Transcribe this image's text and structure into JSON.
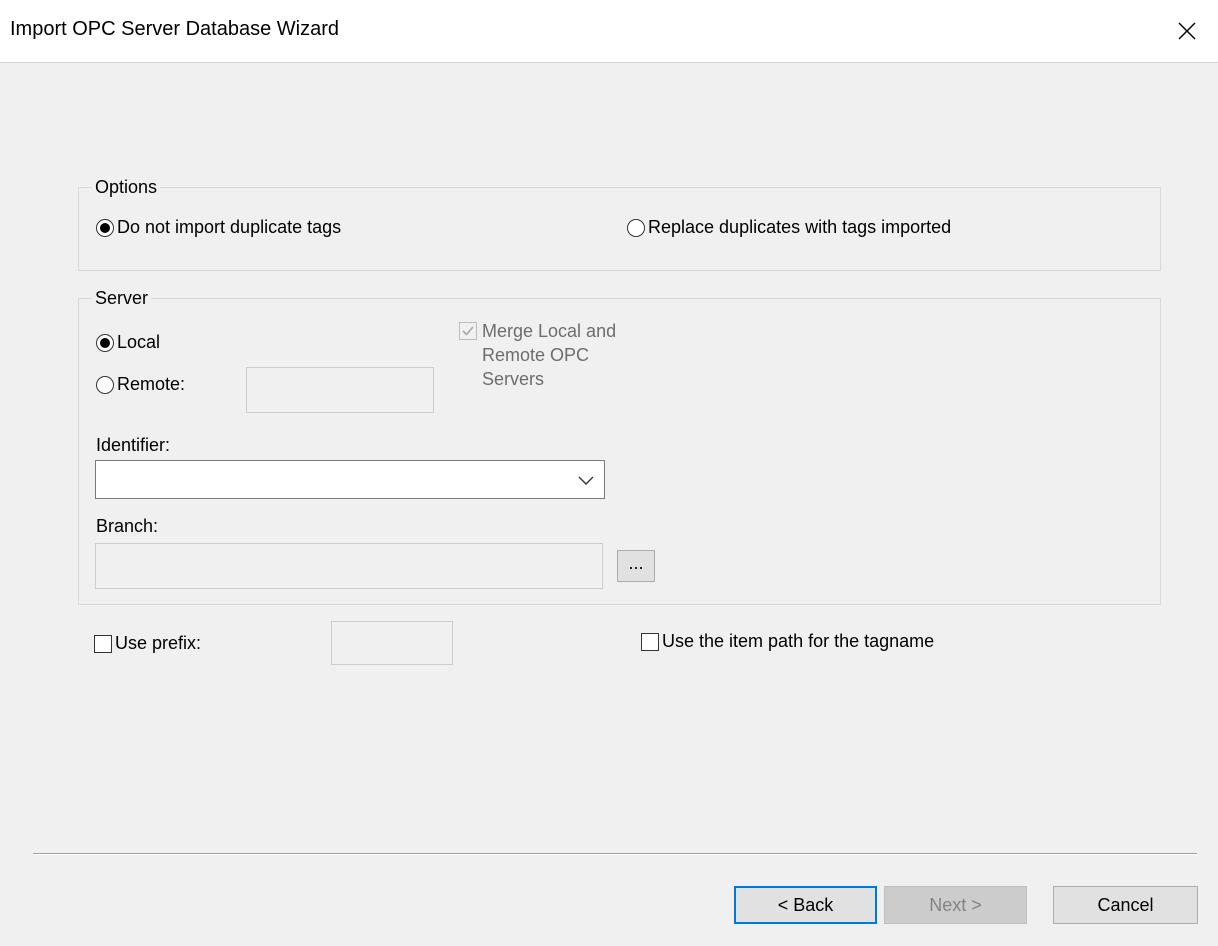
{
  "window": {
    "title": "Import OPC Server Database Wizard"
  },
  "options": {
    "group_label": "Options",
    "do_not_import_label": "Do not import duplicate tags",
    "replace_label": "Replace duplicates with tags imported"
  },
  "server": {
    "group_label": "Server",
    "local_label": "Local",
    "remote_label": "Remote:",
    "merge_label_line1": "Merge Local and",
    "merge_label_line2": "Remote OPC",
    "merge_label_line3": "Servers",
    "identifier_label": "Identifier:",
    "identifier_value": "",
    "branch_label": "Branch:",
    "branch_value": "",
    "browse_label": "..."
  },
  "prefix": {
    "use_prefix_label": "Use prefix:",
    "item_path_label": "Use the item path for the tagname"
  },
  "buttons": {
    "back": "< Back",
    "next": "Next >",
    "cancel": "Cancel"
  }
}
